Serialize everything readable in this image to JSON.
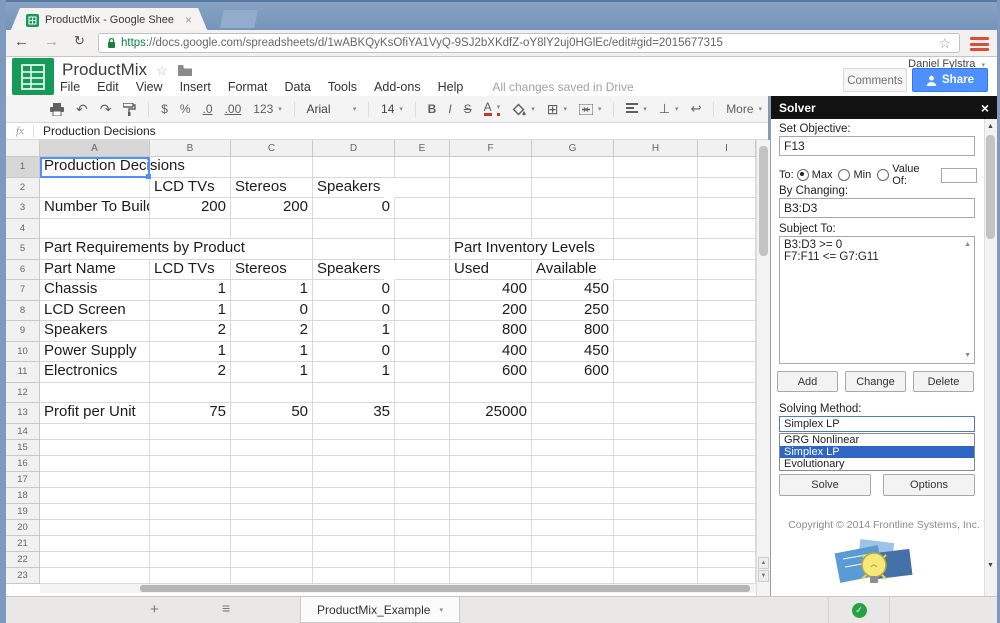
{
  "colors": {
    "accent_blue": "#4d90fe",
    "sheets_green": "#149b57",
    "selection_blue": "#4d90fe",
    "list_highlight": "#2f65c4",
    "saved_green": "#27a346",
    "menu_button_red": "#dd4b39"
  },
  "browser": {
    "tab_title": "ProductMix - Google Shee",
    "url": "https://docs.google.com/spreadsheets/d/1wABKQyKsOfiYA1VyQ-9SJ2bXKdfZ-oY8lY2uj0HGlEc/edit#gid=2015677315"
  },
  "header": {
    "doc_title": "ProductMix",
    "menus": [
      "File",
      "Edit",
      "View",
      "Insert",
      "Format",
      "Data",
      "Tools",
      "Add-ons",
      "Help"
    ],
    "save_status": "All changes saved in Drive",
    "user_name": "Daniel Fylstra",
    "comments_label": "Comments",
    "share_label": "Share"
  },
  "toolbar": {
    "dollar": "$",
    "percent": "%",
    "dec_dec": ".0",
    "inc_dec": ".00",
    "num_fmt": "123",
    "font": "Arial",
    "size": "14",
    "bold": "B",
    "italic": "I",
    "strike": "S",
    "color": "A",
    "more": "More"
  },
  "formula_bar": {
    "fx_label": "fx",
    "content": "Production Decisions"
  },
  "sheet": {
    "columns": [
      "A",
      "B",
      "C",
      "D",
      "E",
      "F",
      "G",
      "H",
      "I"
    ],
    "row_count": 23,
    "selected_cell": "A1",
    "tab_name": "ProductMix_Example",
    "cells": {
      "A1": "Production Decisions",
      "B2": "LCD TVs",
      "C2": "Stereos",
      "D2": "Speakers",
      "A3": "Number To Build",
      "B3": "200",
      "C3": "200",
      "D3": "0",
      "A5": "Part Requirements by Product",
      "F5": "Part Inventory Levels",
      "A6": "Part Name",
      "B6": "LCD TVs",
      "C6": "Stereos",
      "D6": "Speakers",
      "F6": "Used",
      "G6": "Available",
      "A7": "Chassis",
      "B7": "1",
      "C7": "1",
      "D7": "0",
      "F7": "400",
      "G7": "450",
      "A8": "LCD Screen",
      "B8": "1",
      "C8": "0",
      "D8": "0",
      "F8": "200",
      "G8": "250",
      "A9": "Speakers",
      "B9": "2",
      "C9": "2",
      "D9": "1",
      "F9": "800",
      "G9": "800",
      "A10": "Power Supply",
      "B10": "1",
      "C10": "1",
      "D10": "0",
      "F10": "400",
      "G10": "450",
      "A11": "Electronics",
      "B11": "2",
      "C11": "1",
      "D11": "1",
      "F11": "600",
      "G11": "600",
      "A13": "Profit per Unit",
      "B13": "75",
      "C13": "50",
      "D13": "35",
      "F13": "25000"
    }
  },
  "solver": {
    "title": "Solver",
    "set_objective_label": "Set Objective:",
    "objective_value": "F13",
    "to_label": "To:",
    "radio_options": [
      "Max",
      "Min",
      "Value Of:"
    ],
    "selected_radio": "Max",
    "value_of_value": "",
    "by_changing_label": "By Changing:",
    "by_changing_value": "B3:D3",
    "subject_to_label": "Subject To:",
    "constraints": [
      "B3:D3 >= 0",
      "F7:F11 <= G7:G11"
    ],
    "buttons": [
      "Add",
      "Change",
      "Delete"
    ],
    "solving_method_label": "Solving Method:",
    "solving_method_value": "Simplex LP",
    "method_options": [
      "GRG Nonlinear",
      "Simplex LP",
      "Evolutionary"
    ],
    "selected_method": "Simplex LP",
    "solve_label": "Solve",
    "options_label": "Options",
    "copyright": "Copyright © 2014 Frontline Systems, Inc."
  }
}
